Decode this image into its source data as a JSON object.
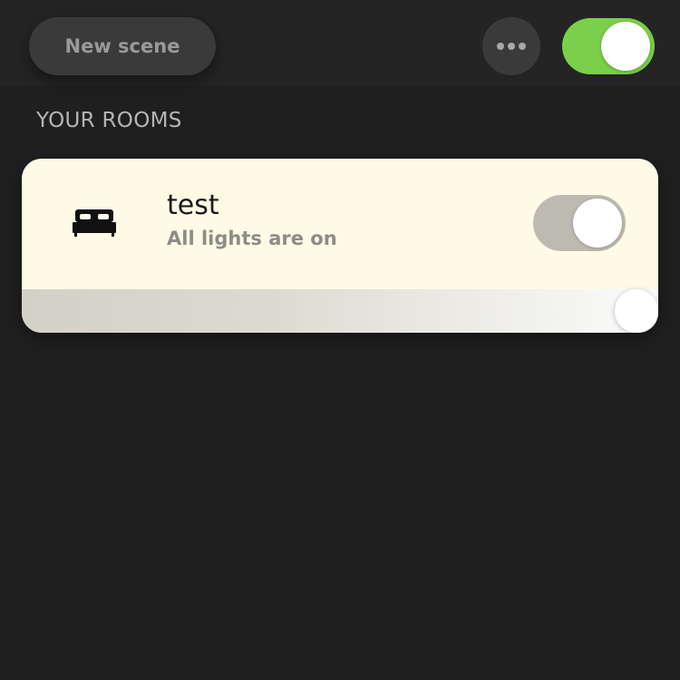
{
  "header": {
    "new_scene_label": "New scene",
    "more_icon": "more-horizontal-icon",
    "master_toggle": {
      "on": true,
      "color": "#7ad04a"
    }
  },
  "rooms_section": {
    "title": "YOUR ROOMS"
  },
  "rooms": [
    {
      "icon": "bed-icon",
      "name": "test",
      "status": "All lights are on",
      "toggle_on": true,
      "brightness": 1.0
    }
  ],
  "colors": {
    "background": "#1f1f1f",
    "card": "#fefae6",
    "accent_green": "#7ad04a"
  }
}
